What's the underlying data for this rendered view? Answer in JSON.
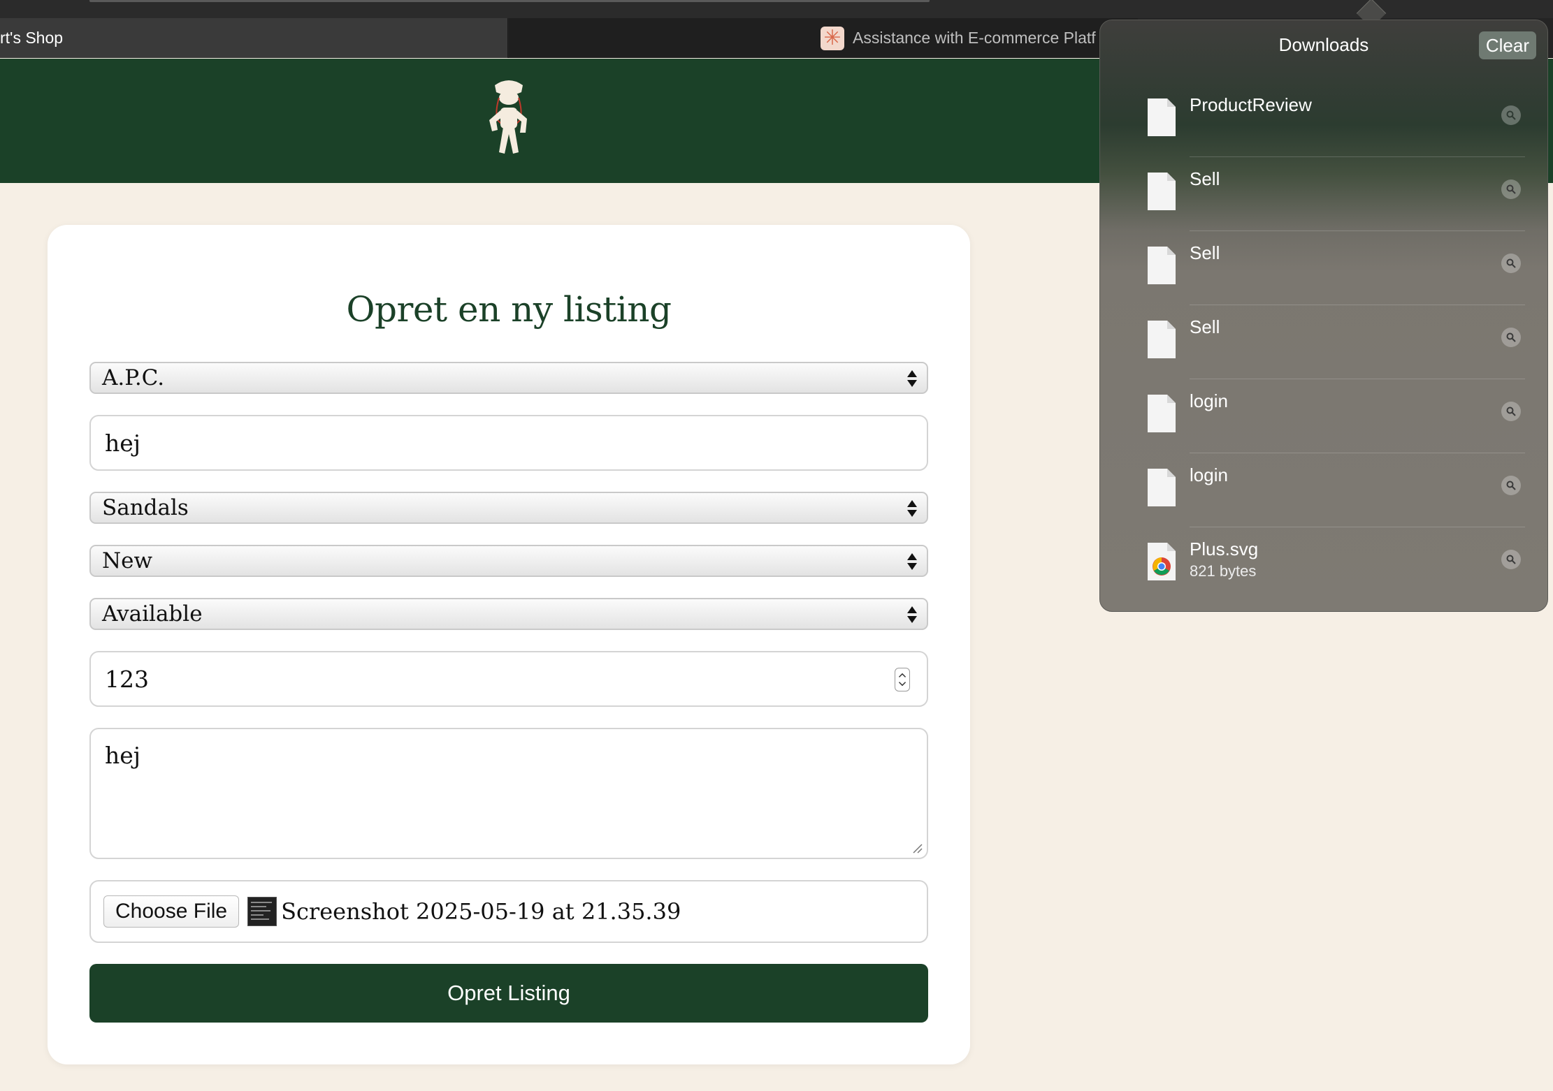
{
  "browser": {
    "active_tab_title": "rt's Shop",
    "inactive_tab_title": "Assistance with E-commerce Platf"
  },
  "form": {
    "title": "Opret en ny listing",
    "brand_select": "A.P.C.",
    "name_input": "hej",
    "category_select": "Sandals",
    "condition_select": "New",
    "status_select": "Available",
    "price_input": "123",
    "description_textarea": "hej",
    "choose_file_label": "Choose File",
    "file_name": "Screenshot 2025‑05‑19 at 21.35.39",
    "submit_label": "Opret Listing"
  },
  "downloads": {
    "title": "Downloads",
    "clear_label": "Clear",
    "items": [
      {
        "name": "ProductReview",
        "detail": "",
        "icon": "document-icon"
      },
      {
        "name": "Sell",
        "detail": "",
        "icon": "document-icon"
      },
      {
        "name": "Sell",
        "detail": "",
        "icon": "document-icon"
      },
      {
        "name": "Sell",
        "detail": "",
        "icon": "document-icon"
      },
      {
        "name": "login",
        "detail": "",
        "icon": "document-icon"
      },
      {
        "name": "login",
        "detail": "",
        "icon": "document-icon"
      },
      {
        "name": "Plus.svg",
        "detail": "821 bytes",
        "icon": "chrome-document-icon"
      }
    ]
  },
  "colors": {
    "brand_green": "#1b4128",
    "page_background": "#f6efe5",
    "card_background": "#ffffff"
  }
}
